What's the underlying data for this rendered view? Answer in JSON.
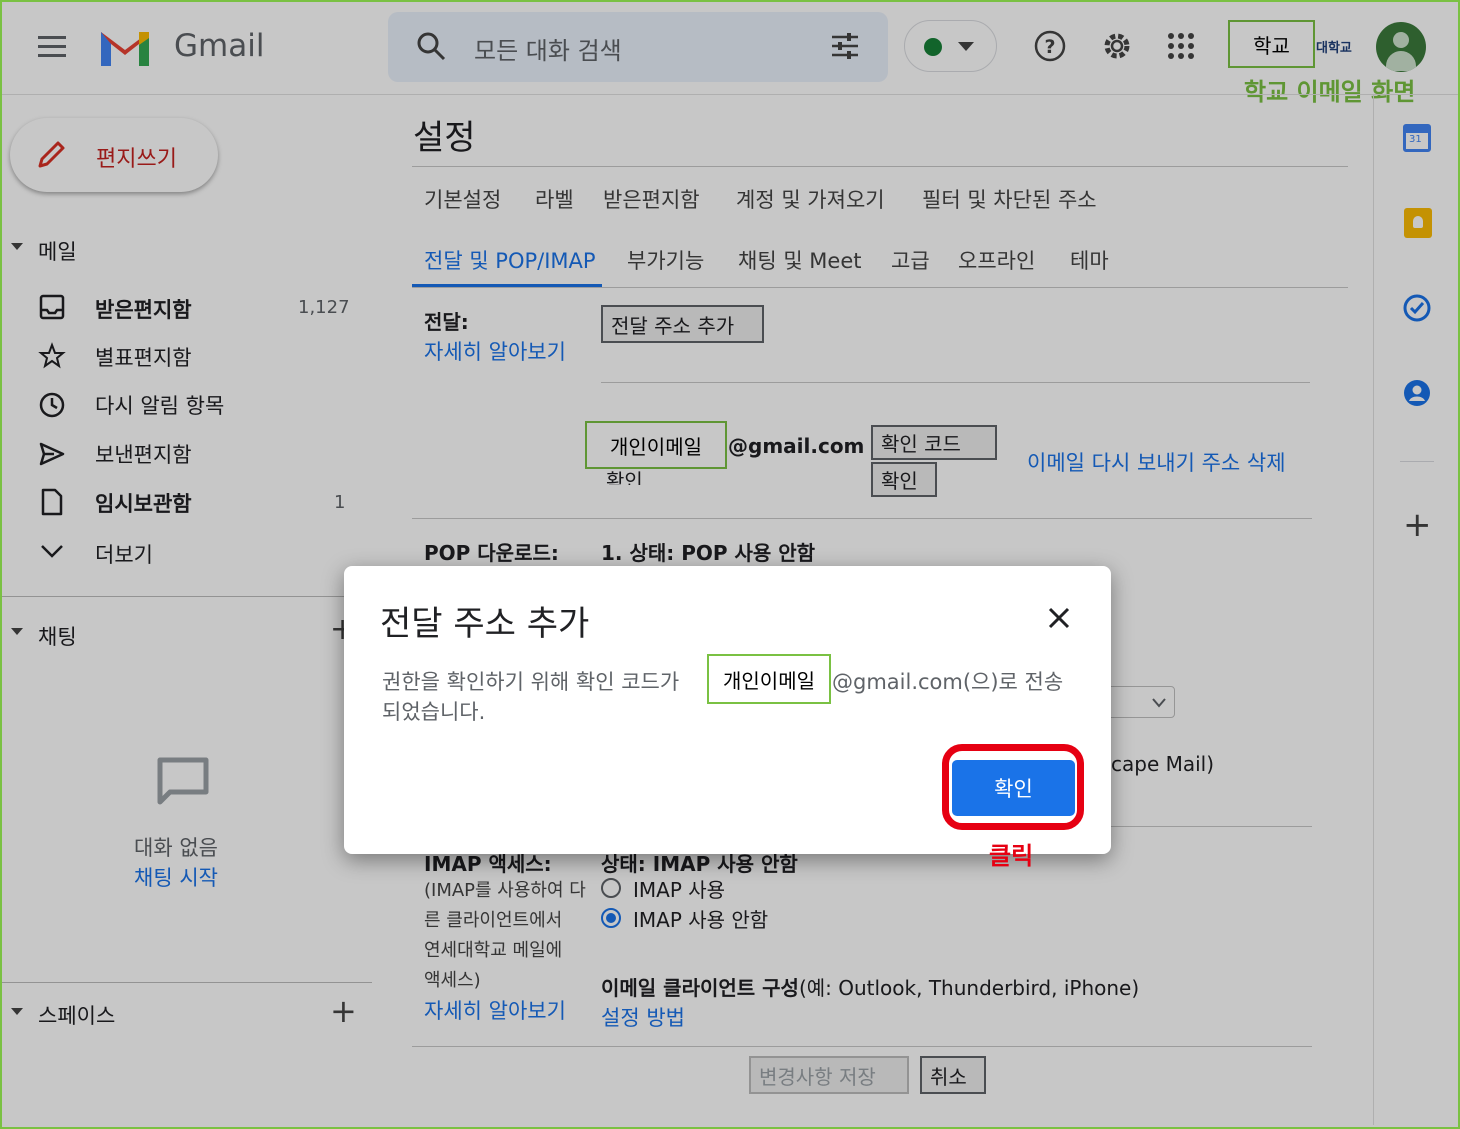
{
  "header": {
    "app_name": "Gmail",
    "search_placeholder": "모든 대화 검색",
    "school_label": "학교",
    "school_logo_text": "대학교",
    "school_annotation": "학교 이메일 화면"
  },
  "sidebar": {
    "compose_label": "편지쓰기",
    "mail_section": "메일",
    "items": [
      {
        "label": "받은편지함",
        "count": "1,127",
        "bold": true
      },
      {
        "label": "별표편지함",
        "count": ""
      },
      {
        "label": "다시 알림 항목",
        "count": ""
      },
      {
        "label": "보낸편지함",
        "count": ""
      },
      {
        "label": "임시보관함",
        "count": "1",
        "bold": true
      },
      {
        "label": "더보기",
        "count": ""
      }
    ],
    "chat_section": "채팅",
    "chat_empty": "대화 없음",
    "chat_start": "채팅 시작",
    "spaces_section": "스페이스"
  },
  "settings": {
    "title": "설정",
    "tabs_row1": [
      "기본설정",
      "라벨",
      "받은편지함",
      "계정 및 가져오기",
      "필터 및 차단된 주소"
    ],
    "tabs_row2": [
      "전달 및 POP/IMAP",
      "부가기능",
      "채팅 및 Meet",
      "고급",
      "오프라인",
      "테마"
    ],
    "forwarding_label": "전달:",
    "learn_more": "자세히 알아보기",
    "add_forward_btn": "전달 주소 추가",
    "personal_email": "개인이메일",
    "gmail_domain": "@gmail.com",
    "confirm_partial": "확인",
    "verify_code_btn": "확인 코드",
    "verify_btn": "확인",
    "resend_delete": "이메일 다시 보내기 주소 삭제",
    "pop_label": "POP 다운로드:",
    "pop_status": "1. 상태: POP 사용 안함",
    "netscape_partial": "cape Mail)",
    "imap_label": "IMAP 액세스:",
    "imap_status": "상태: IMAP 사용 안함",
    "imap_desc_lines": [
      "(IMAP를 사용하여 다",
      "른 클라이언트에서",
      "연세대학교 메일에",
      "액세스)"
    ],
    "imap_on": "IMAP 사용",
    "imap_off": "IMAP 사용 안함",
    "client_config_bold": "이메일 클라이언트 구성",
    "client_config_rest": "(예: Outlook, Thunderbird, iPhone)",
    "setup_link": "설정 방법",
    "save_btn": "변경사항 저장",
    "cancel_btn": "취소"
  },
  "dialog": {
    "title": "전달 주소 추가",
    "msg_pre": "권한을 확인하기 위해 확인 코드가",
    "personal_email": "개인이메일",
    "msg_post": "@gmail.com(으)로 전송",
    "msg_line2": "되었습니다.",
    "ok_label": "확인",
    "click_annotation": "클릭"
  },
  "colors": {
    "accent": "#1a73e8",
    "annotation_green": "#7ac143",
    "annotation_red": "#e60012"
  }
}
